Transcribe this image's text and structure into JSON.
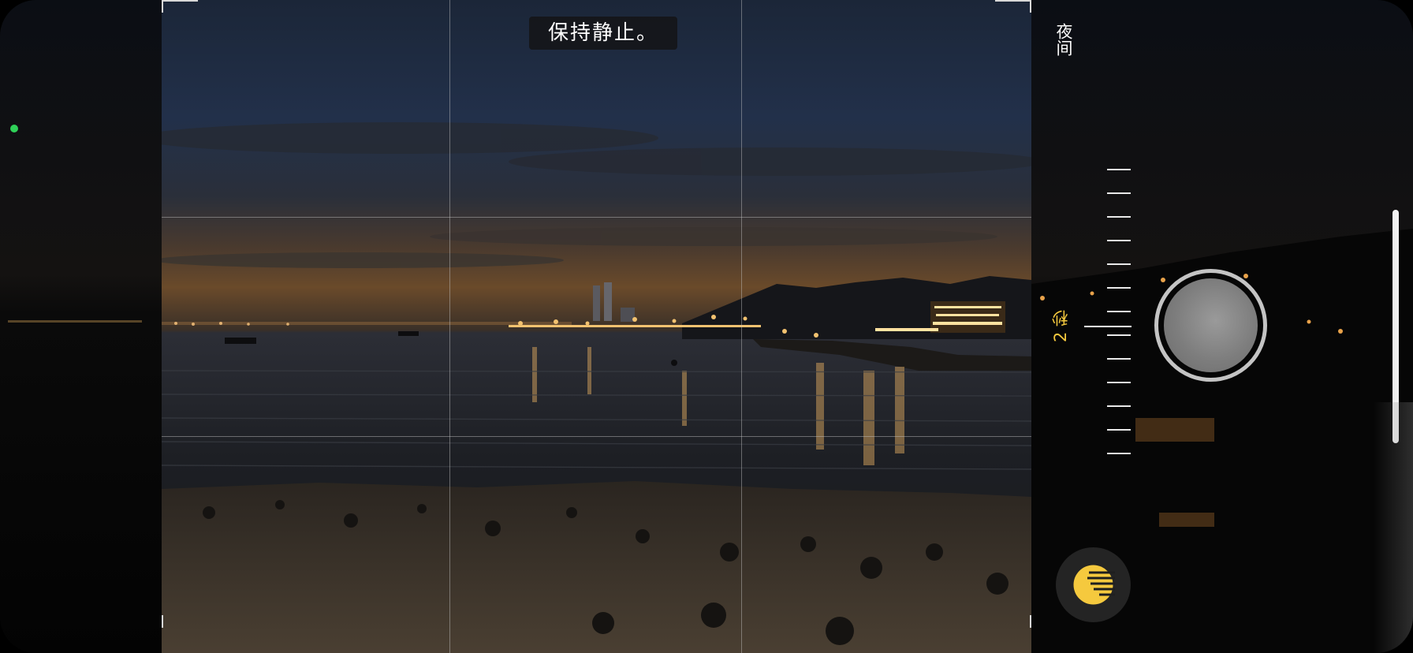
{
  "camera": {
    "hint": "保持静止。",
    "mode_label": "夜间",
    "exposure_label": "2 秒"
  },
  "colors": {
    "accent": "#f5c93e",
    "indicator": "#2fd158"
  },
  "icons": {
    "night_mode": "night-mode-moon-icon",
    "shutter": "shutter-button",
    "camera_indicator": "green-dot-indicator"
  }
}
